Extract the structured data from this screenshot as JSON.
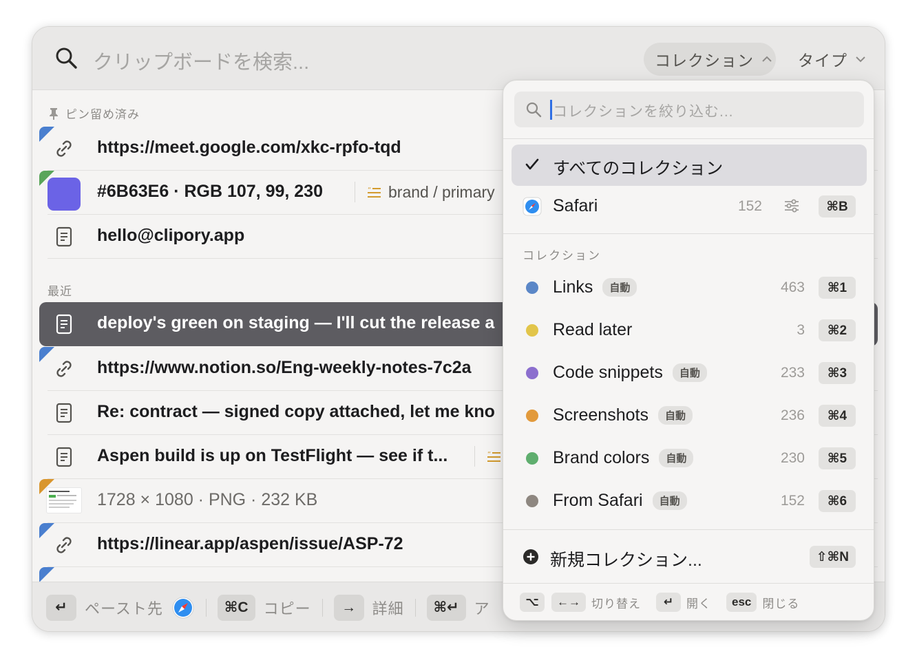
{
  "search": {
    "placeholder": "クリップボードを検索..."
  },
  "filters": {
    "collection_label": "コレクション",
    "type_label": "タイプ"
  },
  "pinned": {
    "section_title": "ピン留め済み",
    "items": [
      {
        "icon": "link-icon",
        "text": "https://meet.google.com/xkc-rpfo-tqd",
        "corner_color": "#4a7fcf"
      },
      {
        "icon": "color-swatch",
        "text": "#6B63E6 · RGB 107, 99, 230",
        "swatch": "#6B63E6",
        "tag": "brand / primary",
        "corner_color": "#5aa55a"
      },
      {
        "icon": "text-document-icon",
        "text": "hello@clipory.app"
      }
    ]
  },
  "recent": {
    "section_title": "最近",
    "items": [
      {
        "icon": "text-document-icon",
        "text": "deploy's green on staging — I'll cut the release a",
        "selected": true
      },
      {
        "icon": "link-icon",
        "text": "https://www.notion.so/Eng-weekly-notes-7c2a",
        "corner_color": "#4a7fcf"
      },
      {
        "icon": "text-document-icon",
        "text": "Re: contract — signed copy attached, let me kno"
      },
      {
        "icon": "text-document-icon",
        "text": "Aspen build is up on TestFlight — see if t..."
      },
      {
        "icon": "image-thumbnail",
        "text": "1728 × 1080 · PNG · 232 KB",
        "corner_color": "#d9962e"
      },
      {
        "icon": "link-icon",
        "text": "https://linear.app/aspen/issue/ASP-72",
        "corner_color": "#4a7fcf"
      }
    ]
  },
  "footer": {
    "paste_key": "↵",
    "paste_label": "ペースト先",
    "copy_key": "⌘C",
    "copy_label": "コピー",
    "detail_key": "→",
    "detail_label": "詳細",
    "action_key": "⌘↵",
    "action_label": "ア"
  },
  "dropdown": {
    "search_placeholder": "コレクションを絞り込む...",
    "all": {
      "label": "すべてのコレクション",
      "checked": true
    },
    "safari": {
      "label": "Safari",
      "count": "152",
      "shortcut": "⌘B"
    },
    "section_title": "コレクション",
    "auto_badge": "自動",
    "collections": [
      {
        "name": "Links",
        "auto": true,
        "count": "463",
        "shortcut": "⌘1",
        "color": "#5b87c7"
      },
      {
        "name": "Read later",
        "auto": false,
        "count": "3",
        "shortcut": "⌘2",
        "color": "#e2c54a"
      },
      {
        "name": "Code snippets",
        "auto": true,
        "count": "233",
        "shortcut": "⌘3",
        "color": "#8c6fce"
      },
      {
        "name": "Screenshots",
        "auto": true,
        "count": "236",
        "shortcut": "⌘4",
        "color": "#e29a3c"
      },
      {
        "name": "Brand colors",
        "auto": true,
        "count": "230",
        "shortcut": "⌘5",
        "color": "#5fae6e"
      },
      {
        "name": "From Safari",
        "auto": true,
        "count": "152",
        "shortcut": "⌘6",
        "color": "#8e8780"
      }
    ],
    "new_collection": {
      "label": "新規コレクション...",
      "shortcut": "⇧⌘N"
    },
    "hints": [
      {
        "key": "⌥",
        "label": ""
      },
      {
        "key": "←→",
        "label": "切り替え"
      },
      {
        "key": "↵",
        "label": "開く"
      },
      {
        "key": "esc",
        "label": "閉じる"
      }
    ]
  }
}
